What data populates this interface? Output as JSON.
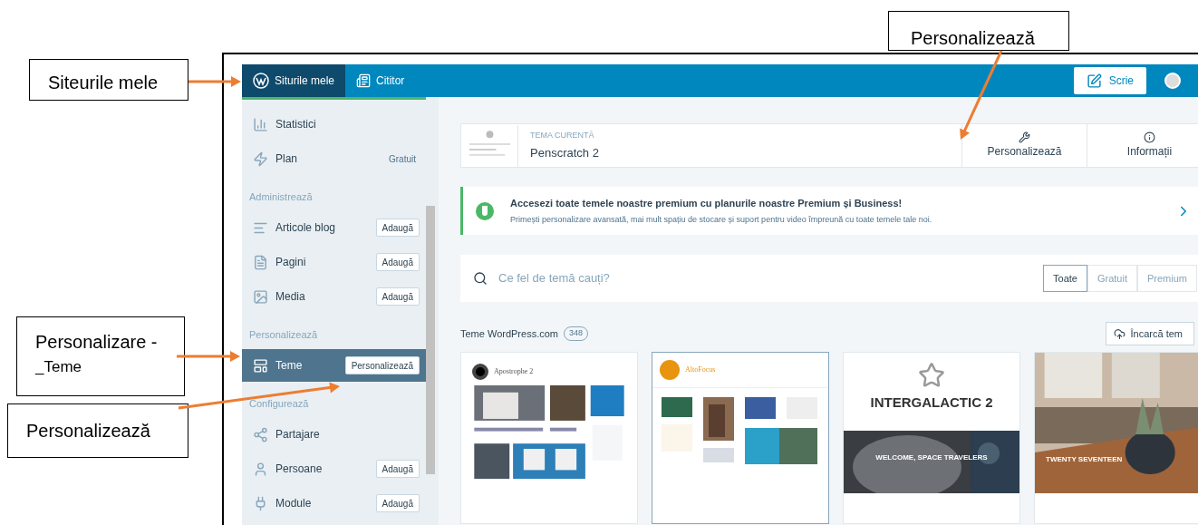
{
  "callouts": [
    {
      "lines": [
        "Siteurile mele"
      ]
    },
    {
      "lines": [
        "Personalizează"
      ]
    },
    {
      "lines": [
        "Personalizare -",
        "_Teme"
      ]
    },
    {
      "lines": [
        "Personalizează"
      ]
    }
  ],
  "topbar": {
    "tabs": [
      {
        "label": "Siturile mele",
        "selected": true
      },
      {
        "label": "Cititor",
        "selected": false
      }
    ],
    "write_button": "Scrie"
  },
  "sidebar": {
    "items": [
      {
        "kind": "item",
        "label": "Statistici",
        "selected": false
      },
      {
        "kind": "item",
        "label": "Plan",
        "note": "Gratuit",
        "selected": false
      },
      {
        "kind": "header",
        "label": "Administrează"
      },
      {
        "kind": "item",
        "label": "Articole blog",
        "action": "Adaugă",
        "selected": false
      },
      {
        "kind": "item",
        "label": "Pagini",
        "action": "Adaugă",
        "selected": false
      },
      {
        "kind": "item",
        "label": "Media",
        "action": "Adaugă",
        "selected": false
      },
      {
        "kind": "header",
        "label": "Personalizează"
      },
      {
        "kind": "item",
        "label": "Teme",
        "action": "Personalizează",
        "selected": true
      },
      {
        "kind": "header",
        "label": "Configurează"
      },
      {
        "kind": "item",
        "label": "Partajare",
        "selected": false
      },
      {
        "kind": "item",
        "label": "Persoane",
        "action": "Adaugă",
        "selected": false
      },
      {
        "kind": "item",
        "label": "Module",
        "action": "Adaugă",
        "selected": false
      }
    ]
  },
  "current_theme": {
    "label": "TEMA CURENTĂ",
    "name": "Penscratch 2",
    "actions": [
      "Personalizează",
      "Informații"
    ]
  },
  "banner": {
    "title": "Accesezi toate temele noastre premium cu planurile noastre Premium și Business!",
    "subtitle": "Primești personalizare avansată, mai mult spațiu de stocare și suport pentru video împreună cu toate temele tale noi."
  },
  "search": {
    "placeholder": "Ce fel de temă cauți?",
    "filters": [
      {
        "label": "Toate",
        "selected": true
      },
      {
        "label": "Gratuit",
        "selected": false
      },
      {
        "label": "Premium",
        "selected": false
      }
    ]
  },
  "section": {
    "title": "Teme WordPress.com",
    "count": "348",
    "upload_button": "Încarcă tem"
  },
  "cards": [
    {
      "kind": "blog",
      "title": "Apostrophe 2",
      "selected": false
    },
    {
      "kind": "gallery",
      "title": "AltoFocus",
      "selected": true
    },
    {
      "kind": "hero",
      "title": "INTERGALACTIC 2",
      "banner": "WELCOME, SPACE TRAVELERS",
      "selected": false
    },
    {
      "banner": "TWENTY SEVENTEEN",
      "selected": false
    }
  ]
}
